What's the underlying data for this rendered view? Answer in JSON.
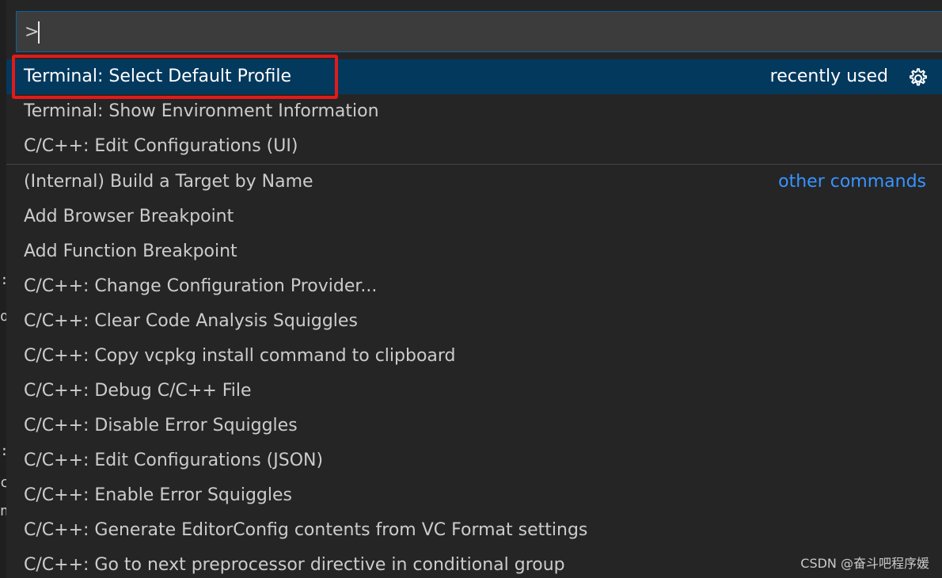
{
  "search": {
    "value": ">",
    "placeholder": ""
  },
  "groups": [
    {
      "items": [
        {
          "label": "Terminal: Select Default Profile",
          "tag": "recently used",
          "selected": true
        },
        {
          "label": "Terminal: Show Environment Information"
        },
        {
          "label": "C/C++: Edit Configurations (UI)"
        }
      ]
    },
    {
      "tag": "other commands",
      "items": [
        {
          "label": "(Internal) Build a Target by Name"
        },
        {
          "label": "Add Browser Breakpoint"
        },
        {
          "label": "Add Function Breakpoint"
        },
        {
          "label": "C/C++: Change Configuration Provider..."
        },
        {
          "label": "C/C++: Clear Code Analysis Squiggles"
        },
        {
          "label": "C/C++: Copy vcpkg install command to clipboard"
        },
        {
          "label": "C/C++: Debug C/C++ File"
        },
        {
          "label": "C/C++: Disable Error Squiggles"
        },
        {
          "label": "C/C++: Edit Configurations (JSON)"
        },
        {
          "label": "C/C++: Enable Error Squiggles"
        },
        {
          "label": "C/C++: Generate EditorConfig contents from VC Format settings"
        },
        {
          "label": "C/C++: Go to next preprocessor directive in conditional group"
        }
      ]
    }
  ],
  "gutter": [
    ":",
    "o",
    ":",
    "c",
    "n"
  ],
  "watermark": "CSDN @奋斗吧程序媛",
  "colors": {
    "selection": "#04395e",
    "focus_border": "#0e639c",
    "group_label": "#3794ff",
    "annotation": "#e21a1a"
  },
  "icons": {
    "configure": "gear-icon"
  }
}
